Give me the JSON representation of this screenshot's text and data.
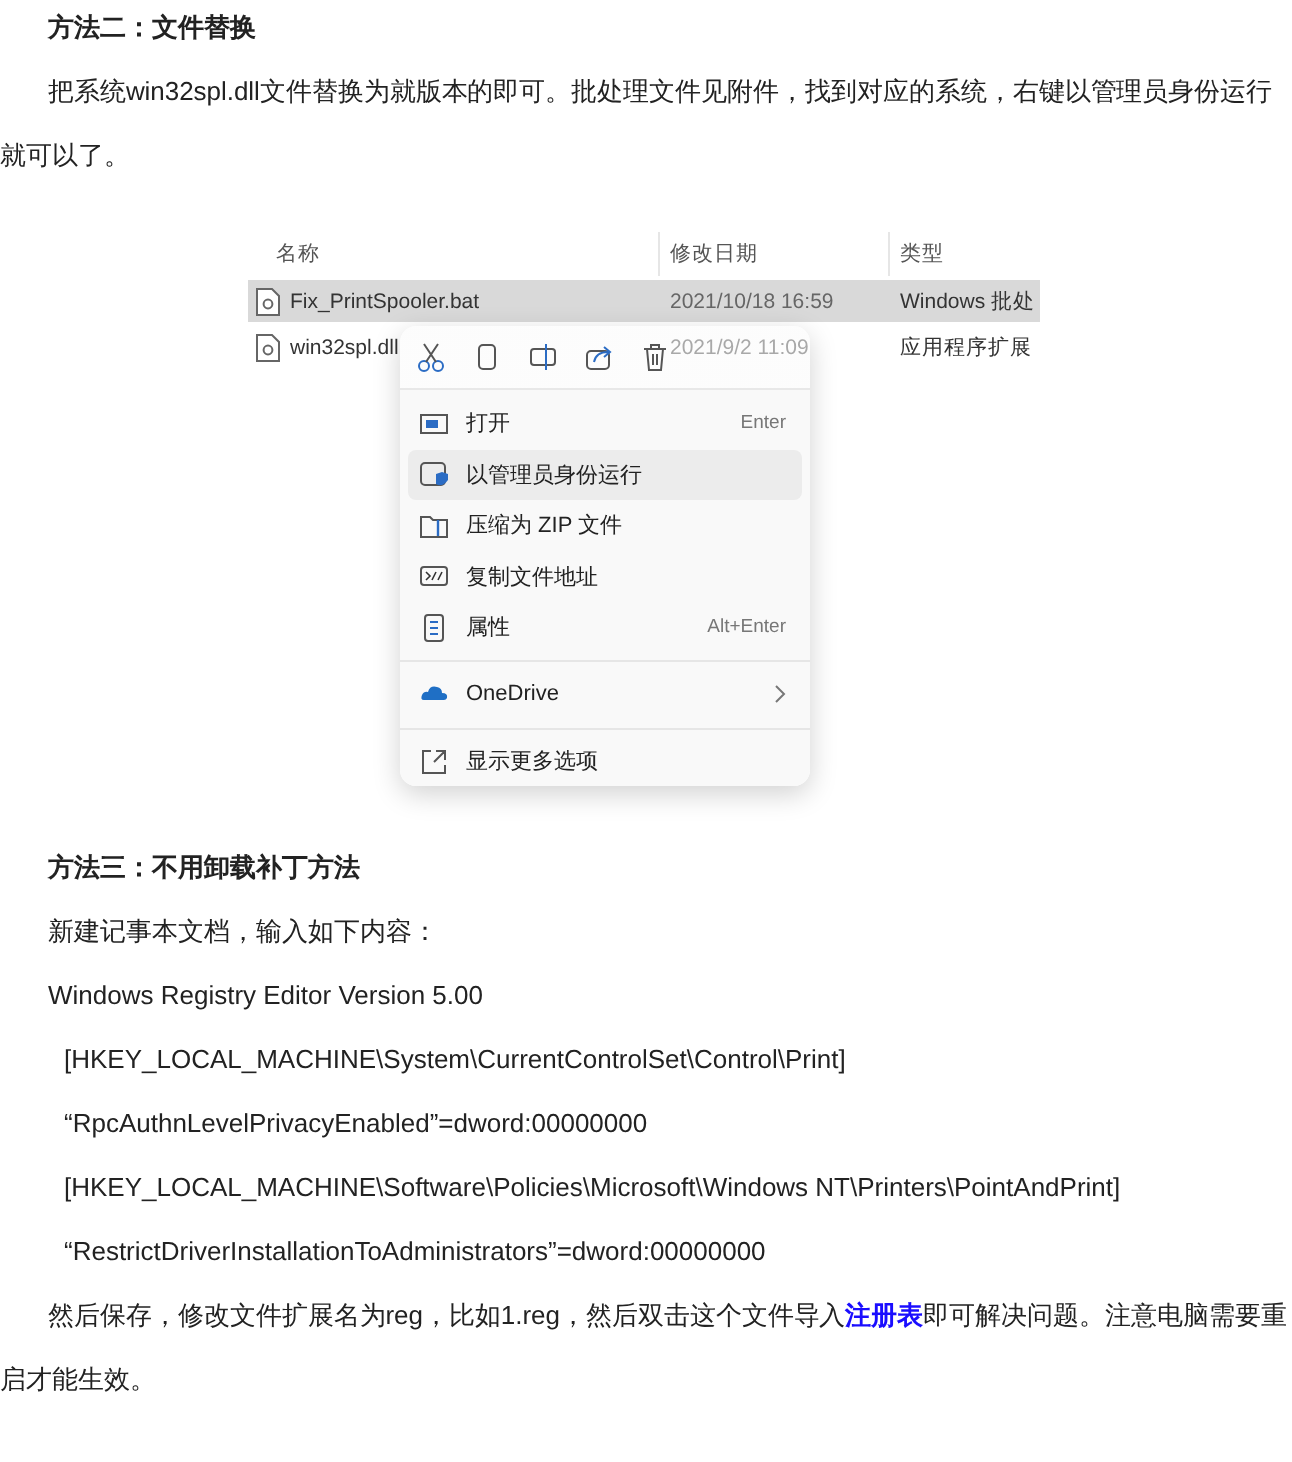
{
  "blocks": [
    {
      "kind": "heading",
      "text": "方法二：文件替换"
    },
    {
      "kind": "paragraph",
      "parts": [
        {
          "text": "把系统win32spl.dll文件替换为就版本的即可。批处理文件见附件，找到对应的系统，右键以管理员身份运行就可以了。"
        }
      ]
    },
    {
      "kind": "figure",
      "columns": [
        "名称",
        "修改日期",
        "类型"
      ],
      "rows": [
        {
          "name": "Fix_PrintSpooler.bat",
          "date": "2021/10/18 16:59",
          "type": "Windows 批处",
          "selected": true
        },
        {
          "name": "win32spl.dll",
          "date": "2021/9/2 11:09",
          "type": "应用程序扩展",
          "selected": false
        }
      ],
      "menu": [
        {
          "kind": "item",
          "label": "打开",
          "shortcut": "Enter",
          "selected": false
        },
        {
          "kind": "item",
          "label": "以管理员身份运行",
          "selected": true
        },
        {
          "kind": "item",
          "label": "压缩为 ZIP 文件",
          "selected": false
        },
        {
          "kind": "item",
          "label": "复制文件地址",
          "selected": false
        },
        {
          "kind": "item",
          "label": "属性",
          "shortcut": "Alt+Enter",
          "selected": false
        },
        {
          "kind": "separator"
        },
        {
          "kind": "submenu",
          "label": "OneDrive",
          "selected": false
        },
        {
          "kind": "separator"
        },
        {
          "kind": "item",
          "label": "显示更多选项",
          "selected": false
        }
      ]
    },
    {
      "kind": "heading",
      "text": "方法三：不用卸载补丁方法"
    },
    {
      "kind": "line",
      "text": "新建记事本文档，输入如下内容："
    },
    {
      "kind": "line",
      "text": "Windows Registry Editor Version 5.00"
    },
    {
      "kind": "registry",
      "text": "[HKEY_LOCAL_MACHINE\\System\\CurrentControlSet\\Control\\Print]"
    },
    {
      "kind": "registry",
      "text": "“RpcAuthnLevelPrivacyEnabled”=dword:00000000"
    },
    {
      "kind": "registry",
      "text": "[HKEY_LOCAL_MACHINE\\Software\\Policies\\Microsoft\\Windows NT\\Printers\\PointAndPrint]"
    },
    {
      "kind": "registry",
      "text": "“RestrictDriverInstallationToAdministrators”=dword:00000000"
    },
    {
      "kind": "paragraph",
      "parts": [
        {
          "text": "然后保存，修改文件扩展名为reg，比如1.reg，然后双击这个文件导入"
        },
        {
          "kind": "link",
          "text": "注册表"
        },
        {
          "text": "即可解决问题。注意电脑需要重启才能生效。"
        }
      ]
    }
  ]
}
